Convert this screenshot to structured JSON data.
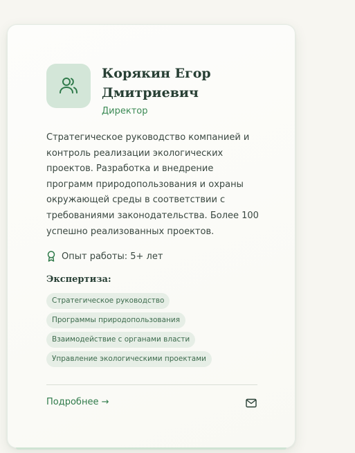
{
  "person": {
    "name": "Корякин Егор Дмитриевич",
    "role": "Директор",
    "avatar_icon": "users-icon",
    "description": "Стратегическое руководство компанией и контроль реализации экологических проектов. Разработка и внедрение программ природопользования и охраны окружающей среды в соответствии с требованиями законодательства. Более 100 успешно реализованных проектов.",
    "experience": "Опыт работы: 5+ лет",
    "experience_icon": "award-icon"
  },
  "expertise": {
    "title": "Экспертиза:",
    "tags": [
      "Стратегическое руководство",
      "Программы природопользования",
      "Взаимодействие с органами власти",
      "Управление экологическими проектами"
    ]
  },
  "footer": {
    "more_label": "Подробнее →",
    "mail_icon": "mail-icon"
  },
  "colors": {
    "page_background": "#f7f6f1",
    "card_background": "#fbfbf7",
    "accent_green": "#2f7a4a",
    "avatar_background": "#d3e6d8",
    "heading_text": "#273f34",
    "tag_background": "#e6eee6"
  }
}
